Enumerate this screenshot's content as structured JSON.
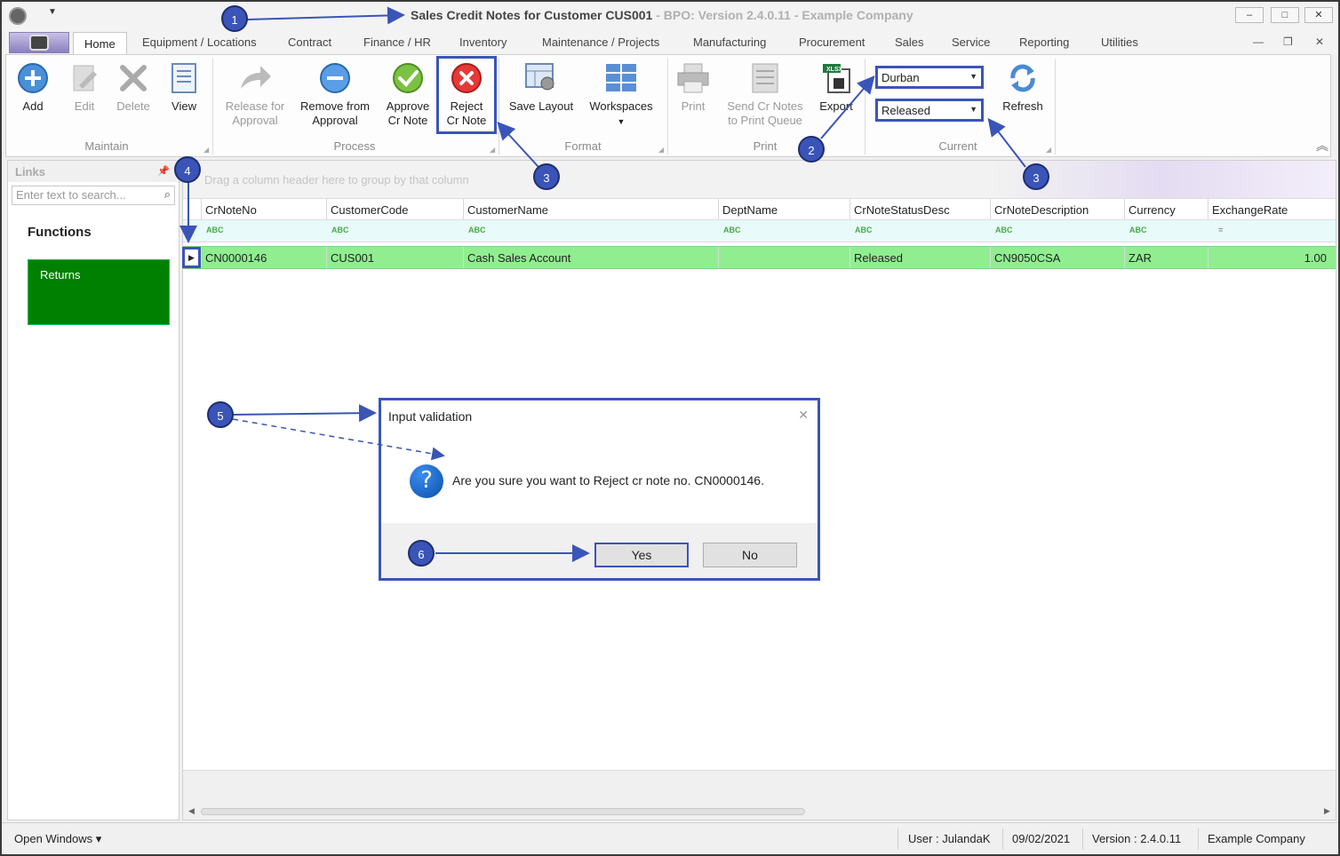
{
  "window": {
    "title_main": "Sales Credit Notes for Customer CUS001",
    "title_dim": " - BPO: Version 2.4.0.11 - Example Company",
    "minimize": "–",
    "maximize": "□",
    "close": "✕"
  },
  "tabs": [
    "Home",
    "Equipment / Locations",
    "Contract",
    "Finance / HR",
    "Inventory",
    "Maintenance / Projects",
    "Manufacturing",
    "Procurement",
    "Sales",
    "Service",
    "Reporting",
    "Utilities"
  ],
  "ribbon": {
    "maintain": {
      "label": "Maintain",
      "add": "Add",
      "edit": "Edit",
      "delete": "Delete",
      "view": "View"
    },
    "process": {
      "label": "Process",
      "release": [
        "Release for",
        "Approval"
      ],
      "remove": [
        "Remove from",
        "Approval"
      ],
      "approve": [
        "Approve",
        "Cr Note"
      ],
      "reject": [
        "Reject",
        "Cr Note"
      ]
    },
    "format": {
      "label": "Format",
      "save_layout": "Save Layout",
      "workspaces": "Workspaces"
    },
    "print": {
      "label": "Print",
      "print": "Print",
      "send": [
        "Send Cr Notes",
        "to Print Queue"
      ],
      "export": "Export",
      "export_badge": "XLSX"
    },
    "current": {
      "label": "Current",
      "site": "Durban",
      "status": "Released",
      "refresh": "Refresh"
    }
  },
  "links": {
    "title": "Links",
    "search_placeholder": "Enter text to search...",
    "functions": "Functions",
    "returns": "Returns"
  },
  "grid": {
    "group_hint": "Drag a column header here to group by that column",
    "columns": [
      "CrNoteNo",
      "CustomerCode",
      "CustomerName",
      "DeptName",
      "CrNoteStatusDesc",
      "CrNoteDescription",
      "Currency",
      "ExchangeRate"
    ],
    "filter_icon": "ABC",
    "rows": [
      [
        "CN0000146",
        "CUS001",
        "Cash Sales Account",
        "",
        "Released",
        "CN9050CSA",
        "ZAR",
        "1.00"
      ]
    ]
  },
  "dialog": {
    "title": "Input validation",
    "message": "Are you sure you want to Reject cr note no. CN0000146.",
    "yes": "Yes",
    "no": "No"
  },
  "statusbar": {
    "open_windows": "Open Windows ▾",
    "user": "User : JulandaK",
    "date": "09/02/2021",
    "version": "Version : 2.4.0.11",
    "company": "Example Company"
  },
  "callouts": [
    "1",
    "2",
    "3",
    "3",
    "4",
    "5",
    "6"
  ],
  "colors": {
    "accent": "#3a54b8",
    "row_highlight": "#90ee90",
    "returns_tile": "#008000"
  }
}
